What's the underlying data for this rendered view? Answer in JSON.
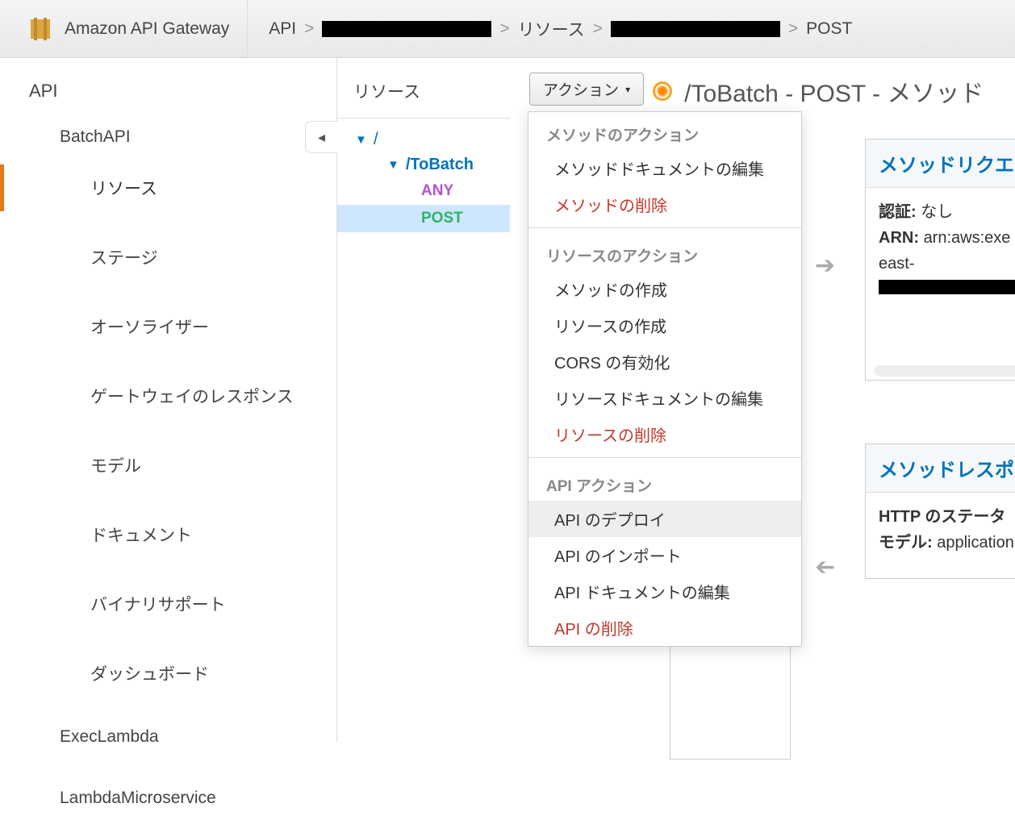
{
  "service_name": "Amazon API Gateway",
  "breadcrumbs": {
    "api": "API",
    "resources": "リソース",
    "method": "POST"
  },
  "sidebar": {
    "title": "API",
    "api_groups": {
      "g1": "BatchAPI",
      "g2": "ExecLambda",
      "g3": "LambdaMicroservice"
    },
    "items": {
      "resources": "リソース",
      "stages": "ステージ",
      "authorizers": "オーソライザー",
      "gwresponses": "ゲートウェイのレスポンス",
      "models": "モデル",
      "documents": "ドキュメント",
      "binary": "バイナリサポート",
      "dashboard": "ダッシュボード"
    }
  },
  "resources": {
    "title": "リソース",
    "root": "/",
    "child": "/ToBatch",
    "methods": {
      "any": "ANY",
      "post": "POST"
    }
  },
  "actions": {
    "button": "アクション",
    "sections": {
      "method": "メソッドのアクション",
      "resource": "リソースのアクション",
      "api": "API アクション"
    },
    "items": {
      "edit_method_doc": "メソッドドキュメントの編集",
      "delete_method": "メソッドの削除",
      "create_method": "メソッドの作成",
      "create_resource": "リソースの作成",
      "enable_cors": "CORS の有効化",
      "edit_resource_doc": "リソースドキュメントの編集",
      "delete_resource": "リソースの削除",
      "deploy_api": "API のデプロイ",
      "import_api": "API のインポート",
      "edit_api_doc": "API ドキュメントの編集",
      "delete_api": "API の削除"
    }
  },
  "page_title": "/ToBatch - POST - メソッド",
  "panels": {
    "request": {
      "title": "メソッドリクエ",
      "auth_label": "認証:",
      "auth_value": "なし",
      "arn_label": "ARN:",
      "arn_value": "arn:aws:exe",
      "arn_value2": "east-"
    },
    "response": {
      "title": "メソッドレスポ",
      "status_label": "HTTP のステータ",
      "model_label": "モデル:",
      "model_value": "application"
    }
  }
}
